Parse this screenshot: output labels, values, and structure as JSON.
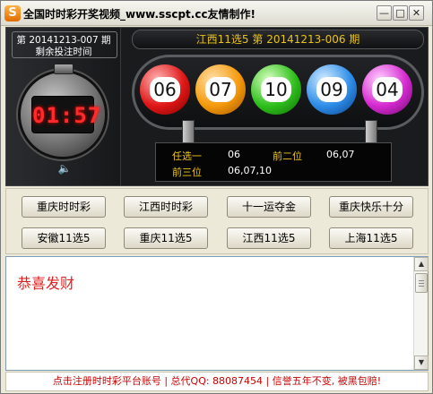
{
  "window": {
    "title": "全国时时彩开奖视频_www.sscpt.cc友情制作!",
    "icon_letter": "S",
    "min": "—",
    "max": "□",
    "close": "✕"
  },
  "countdown": {
    "issue": "第 20141213-007 期",
    "label": "剩余投注时间",
    "time": "01:57",
    "speaker": "🔈"
  },
  "draw": {
    "header": "江西11选5    第 20141213-006 期",
    "balls": [
      "06",
      "07",
      "10",
      "09",
      "04"
    ],
    "results": {
      "r1_label": "任选一",
      "r1_value": "06",
      "r2_label": "前二位",
      "r2_value": "06,07",
      "r3_label": "前三位",
      "r3_value": "06,07,10"
    }
  },
  "lottery_buttons": [
    "重庆时时彩",
    "江西时时彩",
    "十一运夺金",
    "重庆快乐十分",
    "安徽11选5",
    "重庆11选5",
    "江西11选5",
    "上海11选5"
  ],
  "message": {
    "text": "恭喜发财"
  },
  "scrollbar": {
    "up": "▲",
    "down": "▼"
  },
  "footer": {
    "text": "点击注册时时彩平台账号 | 总代QQ: 88087454 | 信誉五年不变, 被黑包赔!"
  },
  "colors": {
    "panel_bg": "#1a1b1d",
    "accent_gold": "#e9c31a",
    "timer_red": "#ff2a2a",
    "message_red": "#e02020",
    "footer_red": "#cc0000"
  }
}
